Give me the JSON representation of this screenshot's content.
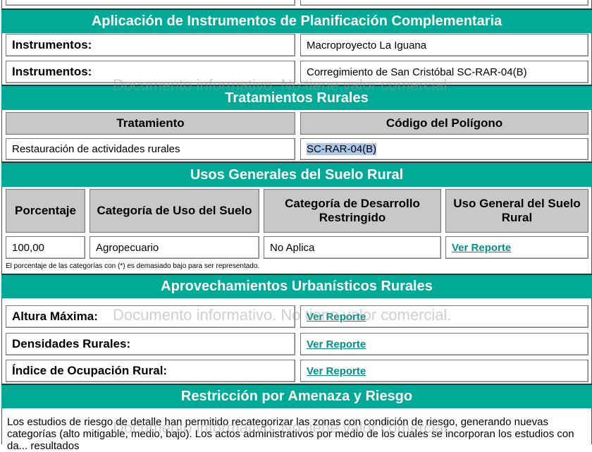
{
  "watermark": "Documento informativo. No tiene valor comercial.",
  "s1": {
    "title": "Aplicación de Instrumentos de Planificación Complementaria",
    "rows": [
      {
        "label": "Instrumentos:",
        "value": "Macroproyecto La Iguana"
      },
      {
        "label": "Instrumentos:",
        "value": "Corregimiento de San Cristóbal SC-RAR-04(B)"
      }
    ]
  },
  "s2": {
    "title": "Tratamientos Rurales",
    "headers": [
      "Tratamiento",
      "Código del Polígono"
    ],
    "row": [
      "Restauración de actividades rurales",
      "SC-RAR-04(B)"
    ]
  },
  "s3": {
    "title": "Usos Generales del Suelo Rural",
    "headers": [
      "Porcentaje",
      "Categoría de Uso del Suelo",
      "Categoría de Desarrollo Restringido",
      "Uso General del Suelo Rural"
    ],
    "row": [
      "100,00",
      "Agropecuario",
      "No Aplica",
      "Ver Reporte"
    ],
    "note": "El porcentaje de las categorías con (*) es demasiado bajo para ser representado."
  },
  "s4": {
    "title": "Aprovechamientos Urbanísticos Rurales",
    "rows": [
      {
        "label": "Altura Máxima:",
        "value": "Ver Reporte"
      },
      {
        "label": "Densidades Rurales:",
        "value": "Ver Reporte"
      },
      {
        "label": "Índice de Ocupación Rural:",
        "value": "Ver Reporte"
      }
    ]
  },
  "s5": {
    "title": "Restricción por Amenaza y Riesgo",
    "text": "Los estudios de riesgo de detalle han permitido recategorizar las zonas con condición de riesgo, generando nuevas categorías (alto mitigable, medio, bajo). Los actos administrativos por medio de los cuales se incorporan los estudios con da... resultados"
  }
}
